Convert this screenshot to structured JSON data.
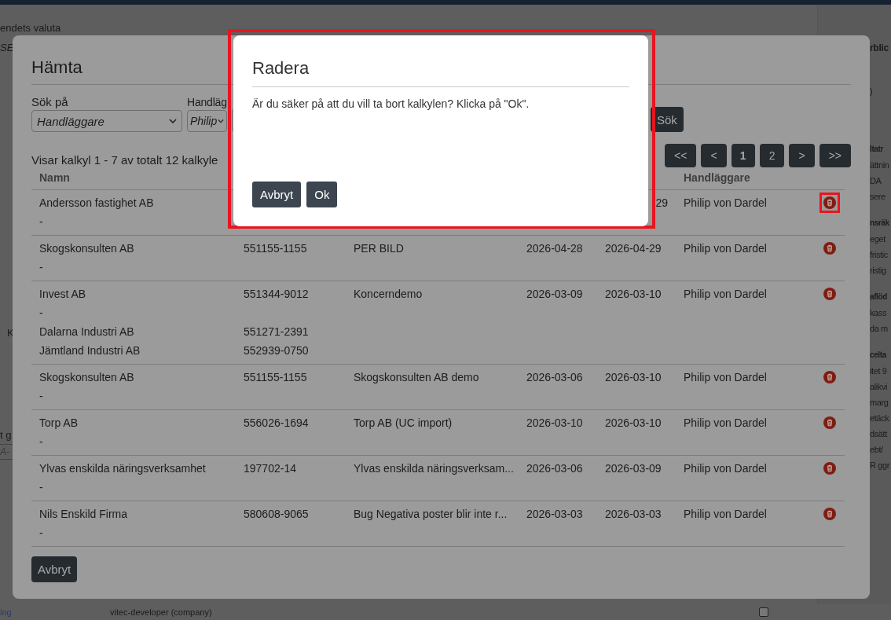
{
  "background": {
    "left_fragments": [
      {
        "kind": "label",
        "text": "endets valuta"
      },
      {
        "kind": "value",
        "text": "SE"
      },
      {
        "kind": "label",
        "text": "K"
      },
      {
        "kind": "label",
        "text": "t g"
      },
      {
        "kind": "placeholder",
        "placeholder": "A-"
      }
    ],
    "right_panel": [
      {
        "kind": "title",
        "text": "rblic"
      },
      {
        "kind": "line",
        "text": ")"
      },
      {
        "kind": "heading",
        "text": "ltatr"
      },
      {
        "kind": "line",
        "text": "ättnin"
      },
      {
        "kind": "line",
        "text": "DA"
      },
      {
        "kind": "line",
        "text": "sere"
      },
      {
        "kind": "heading",
        "text": "nsräk"
      },
      {
        "kind": "line",
        "text": "eget"
      },
      {
        "kind": "line",
        "text": "fristic"
      },
      {
        "kind": "line",
        "text": "ristig"
      },
      {
        "kind": "heading",
        "text": "aflöd"
      },
      {
        "kind": "line",
        "text": "kass"
      },
      {
        "kind": "line",
        "text": "da m"
      },
      {
        "kind": "heading",
        "text": "celta"
      },
      {
        "kind": "line",
        "text": "itet 9"
      },
      {
        "kind": "line",
        "text": "alikvi"
      },
      {
        "kind": "line",
        "text": "marg"
      },
      {
        "kind": "line",
        "text": "etäck"
      },
      {
        "kind": "line",
        "text": "dsätt"
      },
      {
        "kind": "line",
        "text": "ebt/"
      },
      {
        "kind": "line",
        "text": "R ggr"
      }
    ],
    "bottom_row": {
      "label": "ing",
      "owner": "vitec-developer (company)",
      "checked": false
    }
  },
  "fetch_modal": {
    "title": "Hämta",
    "search_on_label": "Sök på",
    "search_on_value": "Handläggare",
    "handler_label": "Handläg",
    "handler_value": "Philip",
    "search_button": "Sök",
    "summary": "Visar kalkyl 1 - 7 av totalt 12 kalkyle",
    "pagination": [
      {
        "label": "<<",
        "selected": false
      },
      {
        "label": "<",
        "selected": false
      },
      {
        "label": "1",
        "selected": true
      },
      {
        "label": "2",
        "selected": false
      },
      {
        "label": ">",
        "selected": false
      },
      {
        "label": ">>",
        "selected": false
      }
    ],
    "columns": [
      "Namn",
      "Handläggare"
    ],
    "rows": [
      {
        "name": "Andersson fastighet AB",
        "note": "-",
        "changed": "29",
        "handler": "Philip von Dardel",
        "highlighted": true
      },
      {
        "name": "Skogskonsulten AB",
        "note": "-",
        "org": "551155-1155",
        "description": "PER BILD",
        "created": "2026-04-28",
        "changed": "2026-04-29",
        "handler": "Philip von Dardel",
        "highlighted": false
      },
      {
        "name": "Invest AB",
        "note": "-",
        "org": "551344-9012",
        "description": "Koncerndemo",
        "created": "2026-03-09",
        "changed": "2026-03-10",
        "handler": "Philip von Dardel",
        "highlighted": false,
        "extra": [
          {
            "name": "Dalarna Industri AB",
            "org": "551271-2391"
          },
          {
            "name": "Jämtland Industri AB",
            "org": "552939-0750"
          }
        ]
      },
      {
        "name": "Skogskonsulten AB",
        "note": "-",
        "org": "551155-1155",
        "description": "Skogskonsulten AB demo",
        "created": "2026-03-06",
        "changed": "2026-03-10",
        "handler": "Philip von Dardel",
        "highlighted": false
      },
      {
        "name": "Torp AB",
        "note": "-",
        "org": "556026-1694",
        "description": "Torp AB (UC import)",
        "created": "2026-03-10",
        "changed": "2026-03-10",
        "handler": "Philip von Dardel",
        "highlighted": false
      },
      {
        "name": "Ylvas enskilda näringsverksamhet",
        "note": "-",
        "org": "197702-14",
        "description": "Ylvas enskilda näringsverksam...",
        "created": "2026-03-06",
        "changed": "2026-03-09",
        "handler": "Philip von Dardel",
        "highlighted": false
      },
      {
        "name": "Nils Enskild Firma",
        "note": "-",
        "org": "580608-9065",
        "description": "Bug Negativa poster blir inte r...",
        "created": "2026-03-03",
        "changed": "2026-03-03",
        "handler": "Philip von Dardel",
        "highlighted": false
      }
    ],
    "cancel_button": "Avbryt"
  },
  "delete_dialog": {
    "title": "Radera",
    "message": "Är du säker på att du vill ta bort kalkylen? Klicka på \"Ok\".",
    "buttons": [
      "Avbryt",
      "Ok"
    ],
    "highlighted": true
  }
}
